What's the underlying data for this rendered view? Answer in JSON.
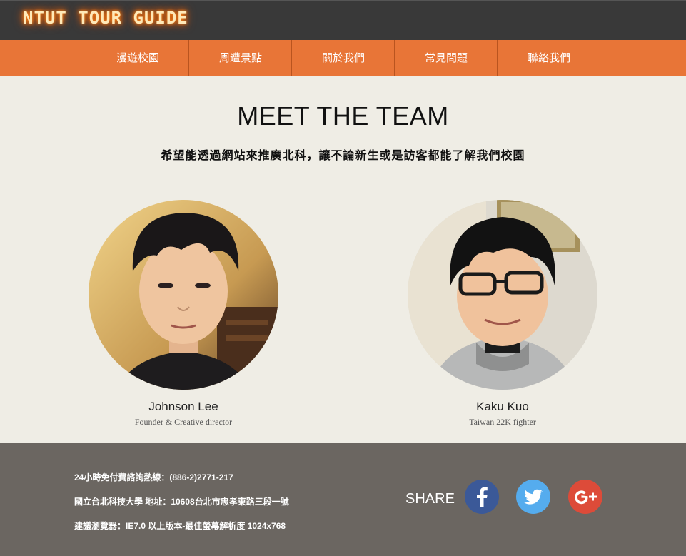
{
  "header": {
    "logo": "NTUT TOUR GUIDE"
  },
  "nav": [
    {
      "label": "漫遊校園"
    },
    {
      "label": "周遭景點"
    },
    {
      "label": "關於我們"
    },
    {
      "label": "常見問題"
    },
    {
      "label": "聯絡我們"
    }
  ],
  "main": {
    "title": "MEET THE TEAM",
    "subtitle": "希望能透過網站來推廣北科，讓不論新生或是訪客都能了解我們校園",
    "members": [
      {
        "name": "Johnson Lee",
        "role": "Founder & Creative director"
      },
      {
        "name": "Kaku Kuo",
        "role": "Taiwan 22K fighter"
      }
    ]
  },
  "footer": {
    "hotline": "24小時免付費諮詢熱線：(886-2)2771-217",
    "address": "國立台北科技大學 地址：10608台北市忠孝東路三段一號",
    "browser": "建議瀏覽器：IE7.0 以上版本-最佳螢幕解析度 1024x768",
    "share_label": "SHARE",
    "social": [
      {
        "icon": "facebook-icon",
        "color": "#3b5998"
      },
      {
        "icon": "twitter-icon",
        "color": "#55acee"
      },
      {
        "icon": "google-plus-icon",
        "color": "#dd4b39"
      }
    ]
  },
  "colors": {
    "header_bg": "#393939",
    "nav_bg": "#e87537",
    "page_bg": "#efede5",
    "footer_bg": "#6b6661"
  }
}
